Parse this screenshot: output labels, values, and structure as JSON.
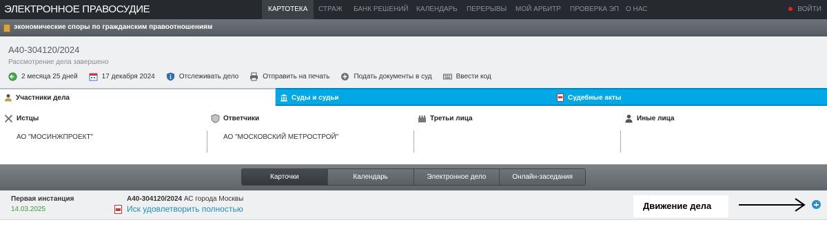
{
  "brand": "ЭЛЕКТРОННОЕ ПРАВОСУДИЕ",
  "nav": {
    "items": [
      "КАРТОТЕКА",
      "СТРАЖ",
      "БАНК РЕШЕНИЙ",
      "КАЛЕНДАРЬ",
      "ПЕРЕРЫВЫ",
      "МОЙ АРБИТР",
      "ПРОВЕРКА ЭП",
      "О НАС"
    ],
    "active": "КАРТОТЕКА",
    "login": "ВОЙТИ"
  },
  "category": "экономические споры по гражданским правоотношениям",
  "case": {
    "number": "А40-304120/2024",
    "status": "Рассмотрение дела завершено",
    "actions": {
      "duration": "2 месяца 25 дней",
      "date": "17 декабря 2024",
      "track": "Отслеживать дело",
      "print": "Отправить на печать",
      "submit": "Подать документы в суд",
      "code": "Ввести код"
    }
  },
  "tabs": {
    "participants": "Участники дела",
    "courts": "Суды и судьи",
    "acts": "Судебные акты"
  },
  "participants": {
    "plaintiffs": {
      "title": "Истцы",
      "value": "АО \"МОСИНЖПРОЕКТ\""
    },
    "defendants": {
      "title": "Ответчики",
      "value": "АО \"МОСКОВСКИЙ МЕТРОСТРОЙ\""
    },
    "third": {
      "title": "Третьи лица",
      "value": ""
    },
    "other": {
      "title": "Иные лица",
      "value": ""
    }
  },
  "views": {
    "cards": "Карточки",
    "calendar": "Календарь",
    "electronic": "Электронное дело",
    "online": "Онлайн-заседания",
    "active": "Карточки"
  },
  "instance": {
    "title": "Первая инстанция",
    "date": "14.03.2025",
    "case_number": "А40-304120/2024",
    "court": "АС города Москвы",
    "decision": "Иск удовлетворить полностью"
  },
  "annotation": "Движение дела",
  "colors": {
    "nav_bg": "#262a2f",
    "tab_blue": "#00a8e6",
    "link_blue": "#1d8fc4",
    "date_green": "#3a9d3a",
    "login_dot": "#e2231a"
  }
}
